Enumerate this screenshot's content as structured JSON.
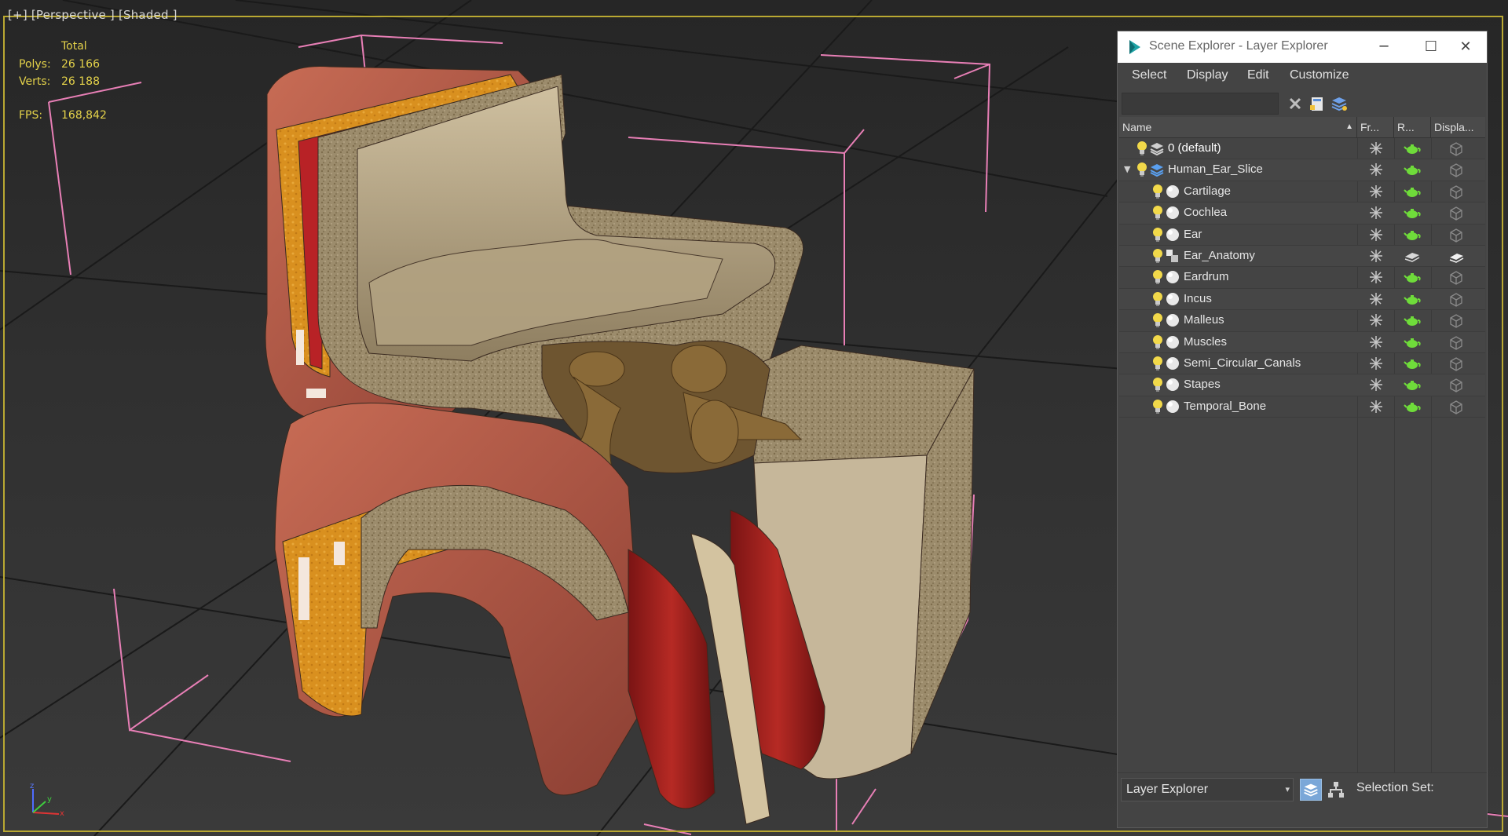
{
  "viewport": {
    "label": "[+] [Perspective ] [Shaded ]",
    "stats": {
      "total_label": "Total",
      "polys_label": "Polys:",
      "polys_value": "26 166",
      "verts_label": "Verts:",
      "verts_value": "26 188",
      "fps_label": "FPS:",
      "fps_value": "168,842"
    },
    "axis": {
      "z": "z",
      "x": "x",
      "y": "y"
    }
  },
  "explorer": {
    "title": "Scene Explorer - Layer Explorer",
    "window_buttons": {
      "minimize": "─",
      "maximize": "☐",
      "close": "✕"
    },
    "menu": [
      "Select",
      "Display",
      "Edit",
      "Customize"
    ],
    "search": {
      "value": "",
      "placeholder": ""
    },
    "columns": {
      "name": "Name",
      "sort_indicator": "▲",
      "freeze": "Fr...",
      "render": "R...",
      "display": "Displa..."
    },
    "rows": [
      {
        "label": "0 (default)",
        "level": 0,
        "type": "layer",
        "expander": "",
        "render_icon": "teapot-icon",
        "display_icon": "box-icon"
      },
      {
        "label": "Human_Ear_Slice",
        "level": 0,
        "type": "layer-active",
        "expander": "▼",
        "render_icon": "teapot-icon",
        "display_icon": "box-icon"
      },
      {
        "label": "Cartilage",
        "level": 1,
        "type": "object",
        "render_icon": "teapot-icon",
        "display_icon": "box-icon"
      },
      {
        "label": "Cochlea",
        "level": 1,
        "type": "object",
        "render_icon": "teapot-icon",
        "display_icon": "box-icon"
      },
      {
        "label": "Ear",
        "level": 1,
        "type": "object",
        "render_icon": "teapot-icon",
        "display_icon": "box-icon"
      },
      {
        "label": "Ear_Anatomy",
        "level": 1,
        "type": "group",
        "render_icon": "layers-icon",
        "display_icon": "layers-icon"
      },
      {
        "label": "Eardrum",
        "level": 1,
        "type": "object",
        "render_icon": "teapot-icon",
        "display_icon": "box-icon"
      },
      {
        "label": "Incus",
        "level": 1,
        "type": "object",
        "render_icon": "teapot-icon",
        "display_icon": "box-icon"
      },
      {
        "label": "Malleus",
        "level": 1,
        "type": "object",
        "render_icon": "teapot-icon",
        "display_icon": "box-icon"
      },
      {
        "label": "Muscles",
        "level": 1,
        "type": "object",
        "render_icon": "teapot-icon",
        "display_icon": "box-icon"
      },
      {
        "label": "Semi_Circular_Canals",
        "level": 1,
        "type": "object",
        "render_icon": "teapot-icon",
        "display_icon": "box-icon"
      },
      {
        "label": "Stapes",
        "level": 1,
        "type": "object",
        "render_icon": "teapot-icon",
        "display_icon": "box-icon"
      },
      {
        "label": "Temporal_Bone",
        "level": 1,
        "type": "object",
        "render_icon": "teapot-icon",
        "display_icon": "box-icon"
      }
    ],
    "bottom": {
      "explorer_select": "Layer Explorer",
      "select_arrow": "▾",
      "selection_set_label": "Selection Set:"
    }
  },
  "colors": {
    "viewport_border": "#b9a832",
    "stats_text": "#e4d24a",
    "bbox_lines": "#e87fb6",
    "bulb": "#f2d94a",
    "render_green": "#6fdc3a"
  }
}
